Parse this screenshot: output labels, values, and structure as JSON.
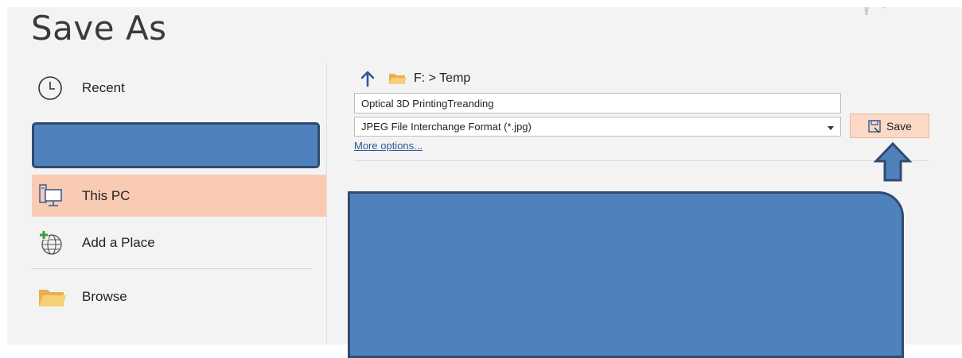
{
  "window": {
    "title": "Save As"
  },
  "nav": {
    "items": [
      {
        "id": "recent",
        "label": "Recent",
        "icon": "clock-icon"
      },
      {
        "id": "this-pc",
        "label": "This PC",
        "icon": "computer-icon",
        "selected": true
      },
      {
        "id": "add-place",
        "label": "Add a Place",
        "icon": "globe-plus-icon"
      },
      {
        "id": "browse",
        "label": "Browse",
        "icon": "folder-icon"
      }
    ]
  },
  "location": {
    "path": "F: > Temp",
    "up_icon": "arrow-up-icon",
    "folder_icon": "folder-icon"
  },
  "file": {
    "name": "Optical 3D PrintingTreanding",
    "type": "JPEG File Interchange Format (*.jpg)"
  },
  "links": {
    "more_options": "More options..."
  },
  "actions": {
    "save_label": "Save",
    "save_icon": "save-icon"
  },
  "colors": {
    "accent": "#2b579a",
    "selected_bg": "#f9cbb3",
    "save_button_bg": "#fbd9c6",
    "redaction": "#4f81bd",
    "redaction_border": "#2f4b6e"
  }
}
